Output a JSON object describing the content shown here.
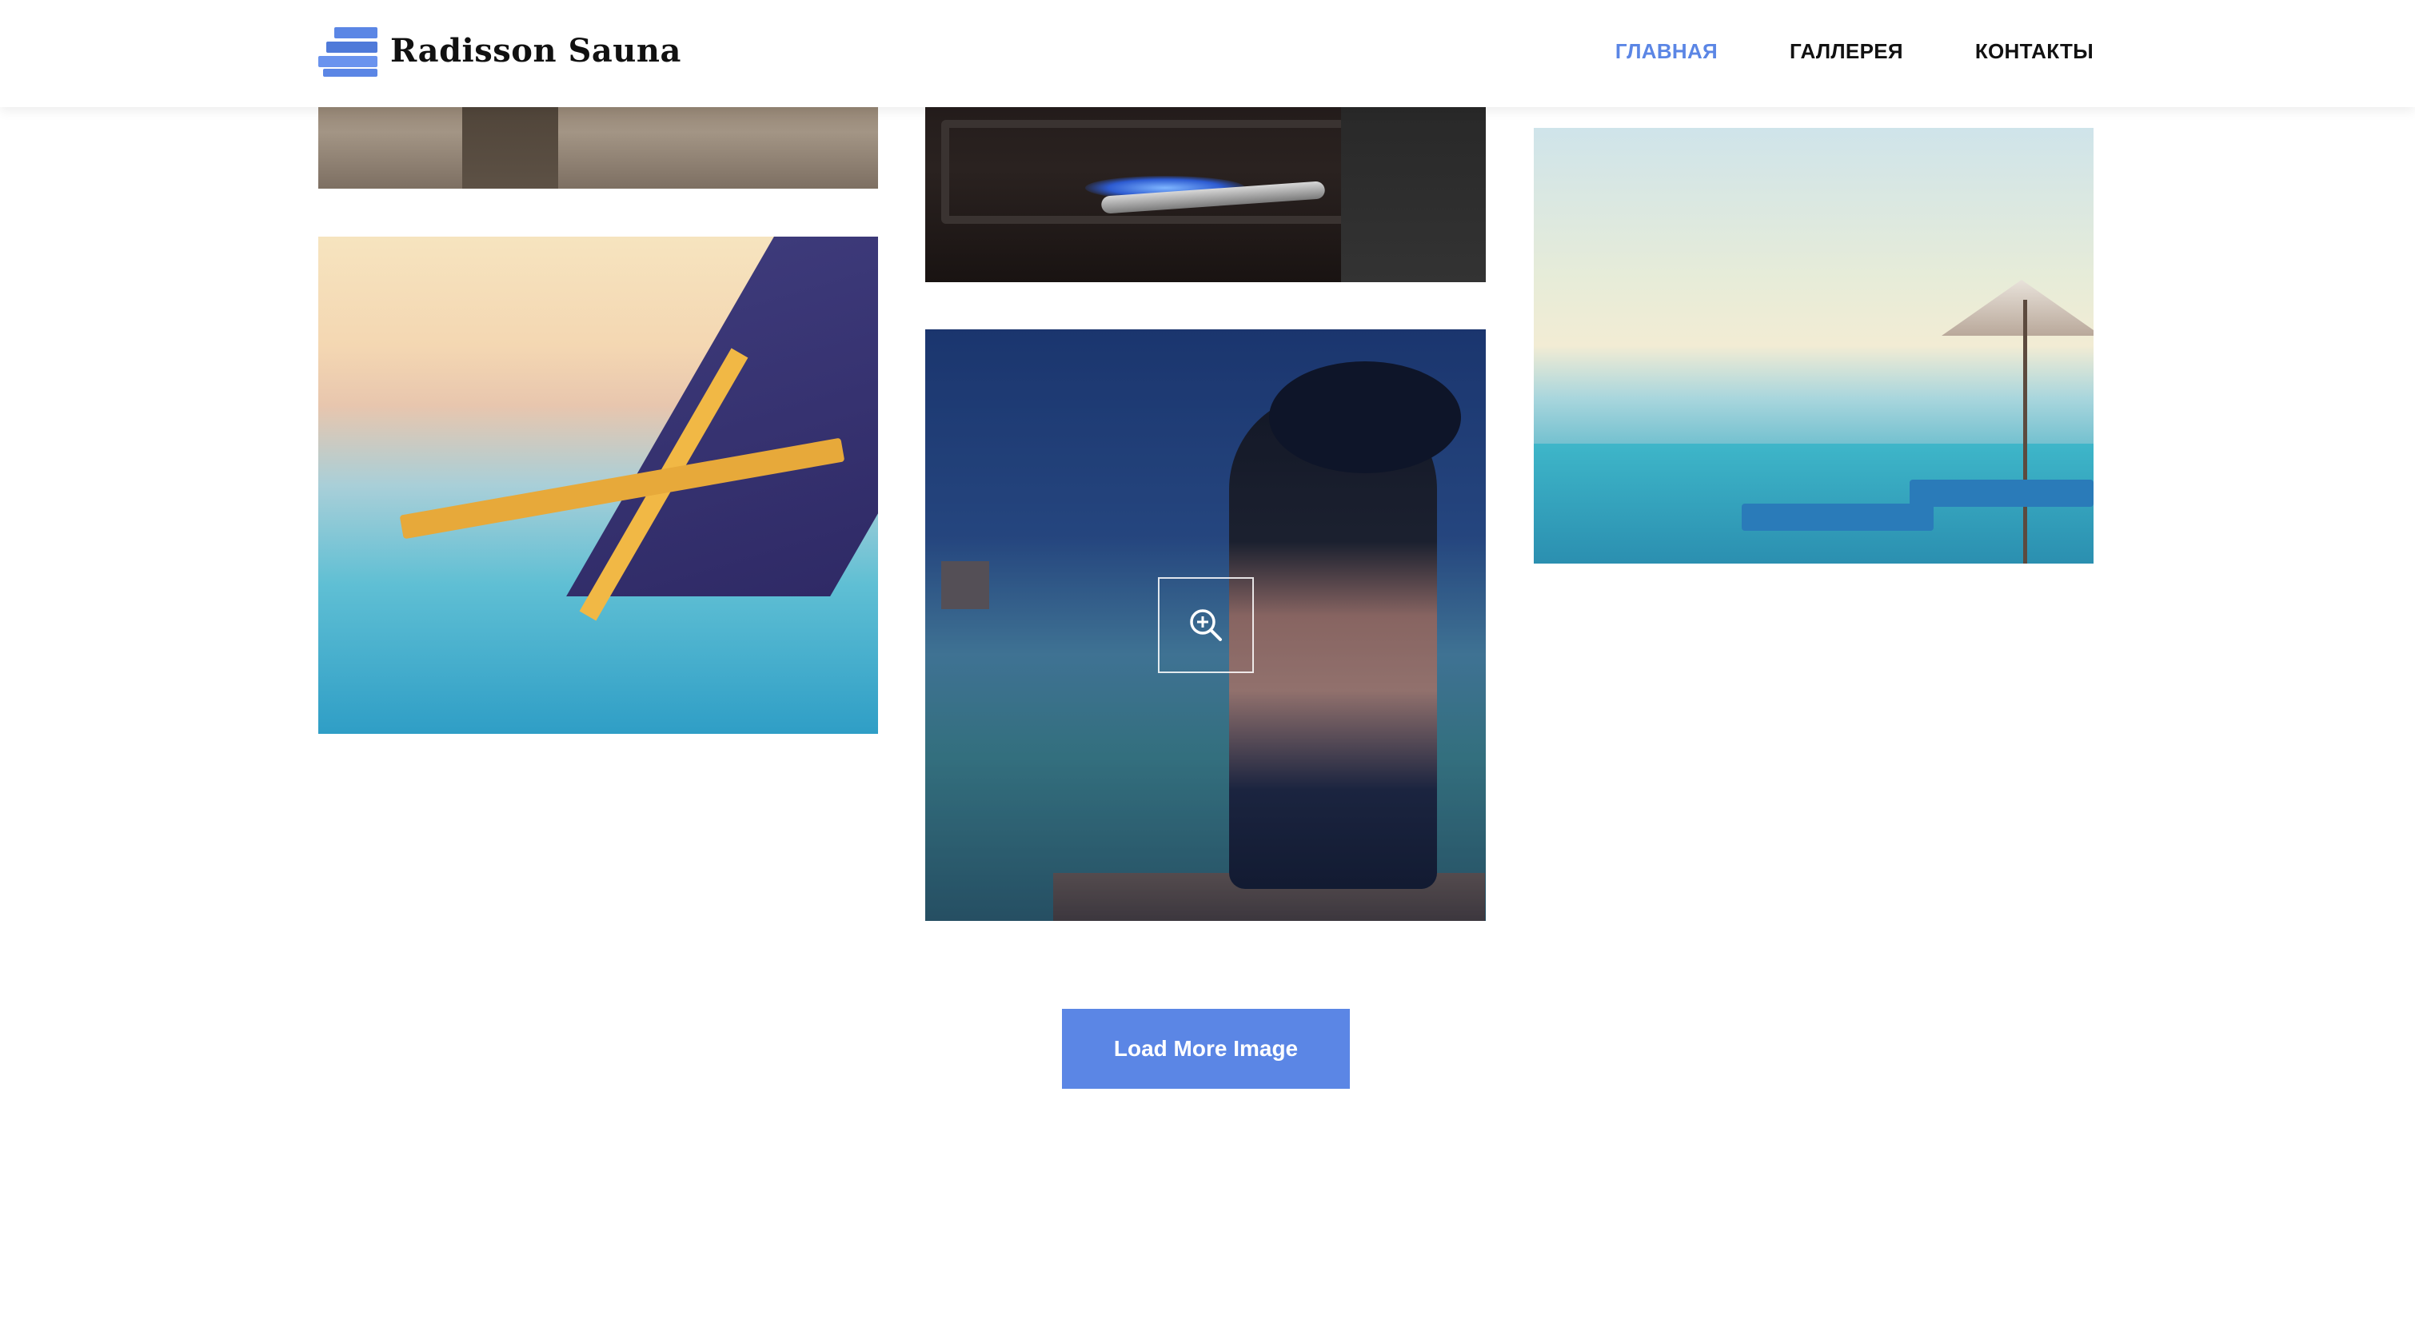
{
  "header": {
    "logo_text": "Radisson Sauna",
    "nav": [
      {
        "label": "ГЛАВНАЯ",
        "active": true
      },
      {
        "label": "ГАЛЛЕРЕЯ",
        "active": false
      },
      {
        "label": "КОНТАКТЫ",
        "active": false
      }
    ]
  },
  "gallery": {
    "zoom_icon": "zoom-in-icon",
    "load_more_label": "Load More Image"
  },
  "colors": {
    "accent": "#5b86e5",
    "nav_text": "#111111",
    "background": "#ffffff"
  }
}
